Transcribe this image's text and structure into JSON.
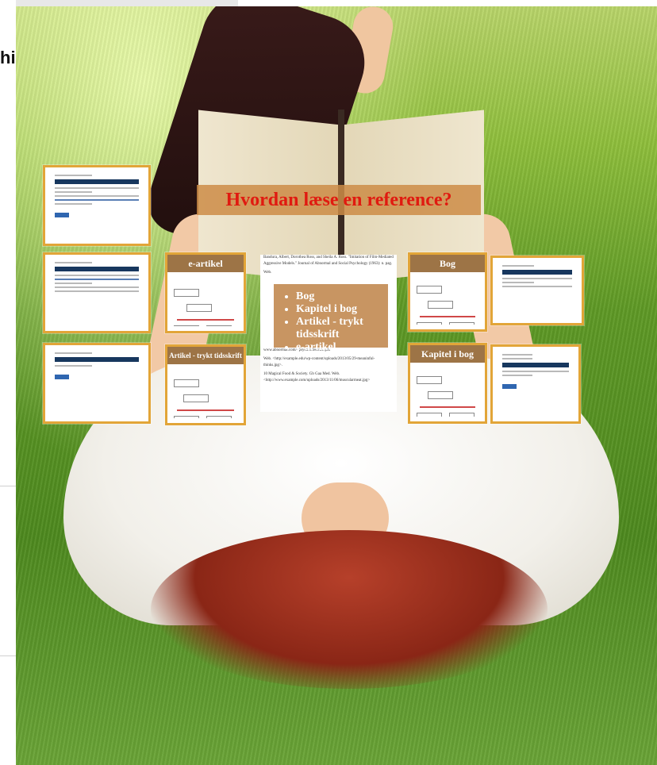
{
  "page": {
    "edge_text": "hi"
  },
  "prezi": {
    "title": "Hvordan læse en reference?",
    "list": [
      "Bog",
      "Kapitel i bog",
      "Artikel - trykt tidsskrift",
      "e-artikel"
    ],
    "frames": {
      "e_artikel": "e-artikel",
      "bog": "Bog",
      "artikel_trykt": "Artikel - trykt tidsskrift",
      "kapitel": "Kapitel i bog"
    },
    "reference_text": [
      "Bandura, Albert, Dorothea Ross, and Sheila A. Ross. \"Imitation of Film-Mediated Aggressive Models.\" Journal of Abnormal and Social Psychology (1963): n. pag.",
      "Web.",
      "www.abnormal.com/~psych/reference.pdf",
      "Web. <http://example.edu/wp-content/uploads/2013/05/29-meaninful-thinks.jpg>.",
      "10 Magical Food & Society. Gb Gaa Med. Web. <http://www.example.com/uploads/2013/11/06/muscularmeat.jpg>"
    ]
  },
  "colors": {
    "frame_border": "#e2a538",
    "title_red": "#e01a10",
    "overlay_brown": "#9d7446"
  }
}
